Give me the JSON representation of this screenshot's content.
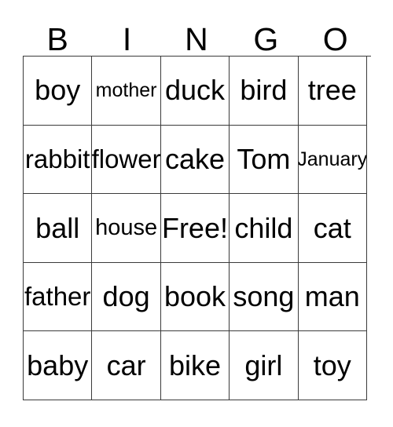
{
  "card": {
    "type": "bingo-card",
    "columns": 5,
    "rows": 5,
    "free_space": "Free!",
    "free_space_position": {
      "row": 3,
      "column": 3
    },
    "header": {
      "letters": [
        "B",
        "I",
        "N",
        "G",
        "O"
      ]
    },
    "grid": [
      {
        "row_index": 1,
        "cells": [
          {
            "text": "boy",
            "fit": "full"
          },
          {
            "text": "mother",
            "fit": "small"
          },
          {
            "text": "duck",
            "fit": "full"
          },
          {
            "text": "bird",
            "fit": "full"
          },
          {
            "text": "tree",
            "fit": "full"
          }
        ]
      },
      {
        "row_index": 2,
        "cells": [
          {
            "text": "rabbit",
            "fit": "large"
          },
          {
            "text": "flower",
            "fit": "large"
          },
          {
            "text": "cake",
            "fit": "full"
          },
          {
            "text": "Tom",
            "fit": "full"
          },
          {
            "text": "January",
            "fit": "small"
          }
        ]
      },
      {
        "row_index": 3,
        "cells": [
          {
            "text": "ball",
            "fit": "full"
          },
          {
            "text": "house",
            "fit": "medium"
          },
          {
            "text": "Free!",
            "fit": "full"
          },
          {
            "text": "child",
            "fit": "full"
          },
          {
            "text": "cat",
            "fit": "full"
          }
        ]
      },
      {
        "row_index": 4,
        "cells": [
          {
            "text": "father",
            "fit": "large"
          },
          {
            "text": "dog",
            "fit": "full"
          },
          {
            "text": "book",
            "fit": "full"
          },
          {
            "text": "song",
            "fit": "full"
          },
          {
            "text": "man",
            "fit": "full"
          }
        ]
      },
      {
        "row_index": 5,
        "cells": [
          {
            "text": "baby",
            "fit": "full"
          },
          {
            "text": "car",
            "fit": "full"
          },
          {
            "text": "bike",
            "fit": "full"
          },
          {
            "text": "girl",
            "fit": "full"
          },
          {
            "text": "toy",
            "fit": "full"
          }
        ]
      }
    ],
    "colors": {
      "background": "#ffffff",
      "border": "#3b3b3b",
      "text": "#000000"
    }
  }
}
